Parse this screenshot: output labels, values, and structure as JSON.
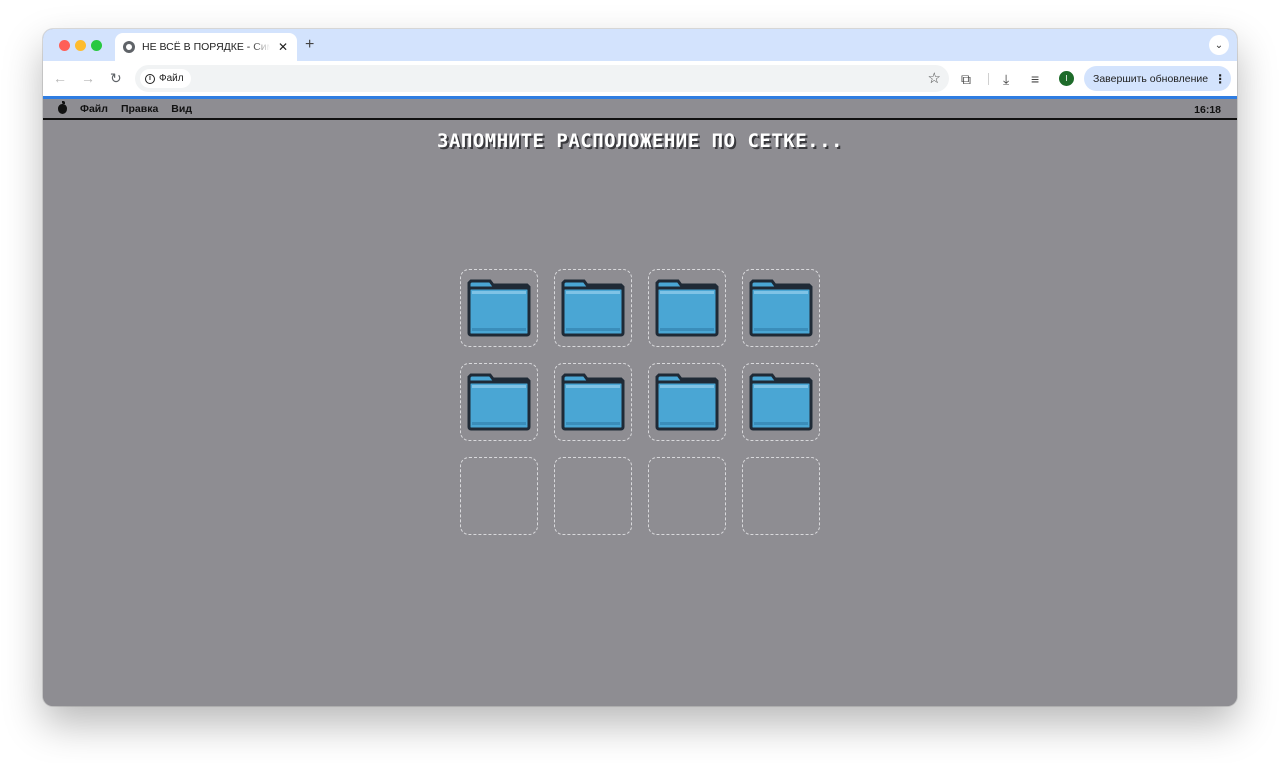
{
  "browser": {
    "tab_title": "НЕ ВСЁ В ПОРЯДКЕ - Симулятор",
    "tab_close": "✕",
    "new_tab": "+",
    "tab_search": "⌄",
    "back": "←",
    "forward": "→",
    "reload": "↻",
    "address_chip": "Файл",
    "star": "☆",
    "extensions": "⧉",
    "downloads": "⤓",
    "media": "≡",
    "profile_initial": "I",
    "update_button": "Завершить обновление",
    "update_menu": "⋮"
  },
  "menubar": {
    "items": [
      "Файл",
      "Правка",
      "Вид"
    ],
    "clock": "16:18"
  },
  "game": {
    "instruction": "ЗАПОМНИТЕ РАСПОЛОЖЕНИЕ ПО СЕТКЕ...",
    "grid": {
      "rows": 3,
      "columns": 4,
      "cells": [
        true,
        true,
        true,
        true,
        true,
        true,
        true,
        true,
        false,
        false,
        false,
        false
      ]
    }
  },
  "colors": {
    "desktop_bg": "#8e8d92",
    "folder_fill": "#4aa6d4",
    "folder_outline": "#1f2a36",
    "accent_bar": "#2f7de1"
  }
}
